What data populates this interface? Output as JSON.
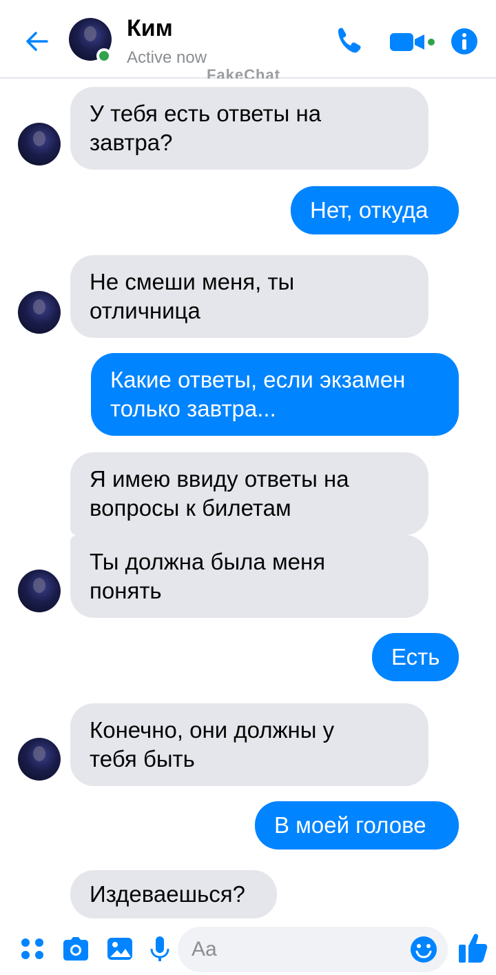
{
  "header": {
    "contact_name": "Ким",
    "status": "Active now",
    "watermark": "FakeChat"
  },
  "messages": [
    {
      "direction": "in",
      "lines": [
        "У тебя есть ответы на",
        "завтра?"
      ]
    },
    {
      "direction": "out",
      "lines": [
        "Нет, откуда"
      ]
    },
    {
      "direction": "in",
      "lines": [
        "Не смеши меня, ты",
        "отличница"
      ]
    },
    {
      "direction": "out",
      "lines": [
        "Какие ответы, если экзамен",
        "только завтра..."
      ]
    },
    {
      "direction": "in",
      "lines": [
        "Я имею ввиду ответы на",
        "вопросы к билетам"
      ]
    },
    {
      "direction": "in",
      "lines": [
        "Ты должна была меня",
        "понять"
      ]
    },
    {
      "direction": "out",
      "lines": [
        "Есть"
      ]
    },
    {
      "direction": "in",
      "lines": [
        "Конечно, они должны у",
        "тебя быть"
      ]
    },
    {
      "direction": "out",
      "lines": [
        "В моей голове"
      ]
    },
    {
      "direction": "in",
      "lines": [
        "Издеваешься?"
      ]
    }
  ],
  "composer": {
    "placeholder": "Aa"
  },
  "colors": {
    "accent": "#0084ff",
    "incoming_bubble": "#e4e6eb",
    "online": "#31a24c"
  },
  "icons": [
    "back-arrow-icon",
    "phone-icon",
    "video-camera-icon",
    "info-icon",
    "apps-grid-icon",
    "camera-icon",
    "gallery-icon",
    "microphone-icon",
    "emoji-icon",
    "thumbs-up-icon"
  ]
}
